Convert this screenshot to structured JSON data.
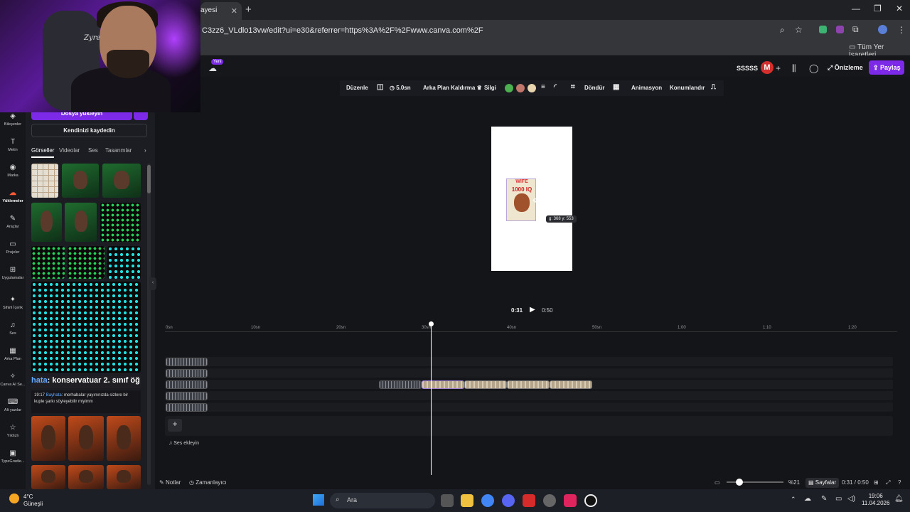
{
  "browser": {
    "tab_title": "ayesi",
    "url": "C3zz6_VLdlo13vw/edit?ui=e30&referrer=https%3A%2F%2Fwww.canva.com%2F",
    "bookmarks_label": "Tüm Yer İşaretleri"
  },
  "header": {
    "new_badge": "Yeni",
    "doc_name": "SSSSS",
    "avatar_letter": "M",
    "preview_label": "Önizleme",
    "share_label": "Paylaş"
  },
  "toolbar": {
    "edit": "Düzenle",
    "duration": "5.0sn",
    "bg_remove": "Arka Plan Kaldırma",
    "eraser": "Silgi",
    "rotate": "Döndür",
    "animate": "Animasyon",
    "position": "Konumlandır",
    "colors": [
      "#4caf50",
      "#c0766a",
      "#e8d5b0"
    ]
  },
  "rail": [
    "Bileşenler",
    "Metin",
    "Marka",
    "Yüklemeler",
    "Araçlar",
    "Projeler",
    "Uygulamalar",
    "Sihirli İçerik",
    "Ses",
    "Arka Plan",
    "Canva AI Se...",
    "Alt yazılar",
    "Yıldızlı",
    "TypeGradie..."
  ],
  "panel": {
    "upload_label": "Dosya yükleyin",
    "more_label": "•••",
    "record_label": "Kendinizi kaydedin",
    "tabs": [
      "Görseller",
      "Videolar",
      "Ses",
      "Tasarımlar"
    ]
  },
  "chat": {
    "banner_user": "hata",
    "banner_text": ": konservatuar 2. sınıf öğ",
    "time": "19:17",
    "user": "Bayhata",
    "message": ": merhabalar yayınınızda sizlere bir kuple şarkı söyleyebilir miyimm"
  },
  "webcam": {
    "chair_text": "Zyre"
  },
  "canvas": {
    "sticker_line1": "WIFE",
    "sticker_line2": "1000 IQ",
    "coord_label": "g: 368 y: 553"
  },
  "playback": {
    "current": "0:31",
    "total": "0:50"
  },
  "timeline": {
    "ticks": [
      "0sn",
      "10sn",
      "20sn",
      "30sn",
      "40sn",
      "50sn",
      "1:00",
      "1:10",
      "1:20"
    ],
    "add_audio": "Ses ekleyin"
  },
  "bottom": {
    "notes": "Notlar",
    "timer": "Zamanlayıcı",
    "zoom": "%21",
    "pages": "Sayfalar",
    "time": "0:31 / 0:50"
  },
  "taskbar": {
    "temp": "4°C",
    "weather": "Güneşli",
    "search": "Ara",
    "time": "19:06",
    "date": "11.04.2026"
  }
}
